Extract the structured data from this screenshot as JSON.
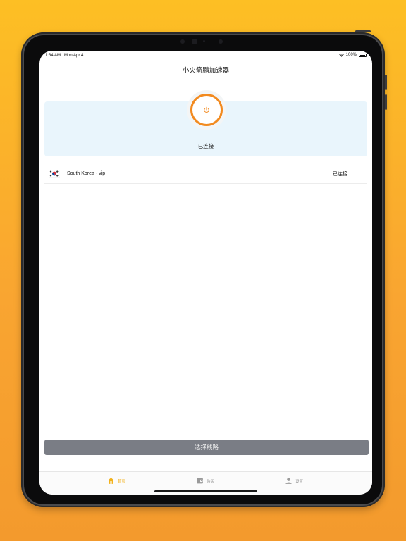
{
  "status_bar": {
    "time": "1:34 AM",
    "date": "Mon Apr 4",
    "battery": "100%"
  },
  "nav": {
    "title": "小火箭鹏加速器"
  },
  "connection": {
    "status_text": "已连接",
    "power_icon": "power-icon",
    "accent_color": "#f28a1f"
  },
  "server": {
    "name": "South Korea - vip",
    "status": "已连接",
    "flag_icon": "south-korea-flag-icon"
  },
  "select_route": {
    "label": "选择线路"
  },
  "tabs": [
    {
      "label": "首页",
      "icon": "home-icon",
      "active": true
    },
    {
      "label": "购买",
      "icon": "purchase-icon",
      "active": false
    },
    {
      "label": "设置",
      "icon": "user-icon",
      "active": false
    }
  ],
  "colors": {
    "background": "#fdbf24",
    "panel": "#e9f5fc",
    "button": "#7a7d85",
    "tab_active": "#f2b21c"
  }
}
